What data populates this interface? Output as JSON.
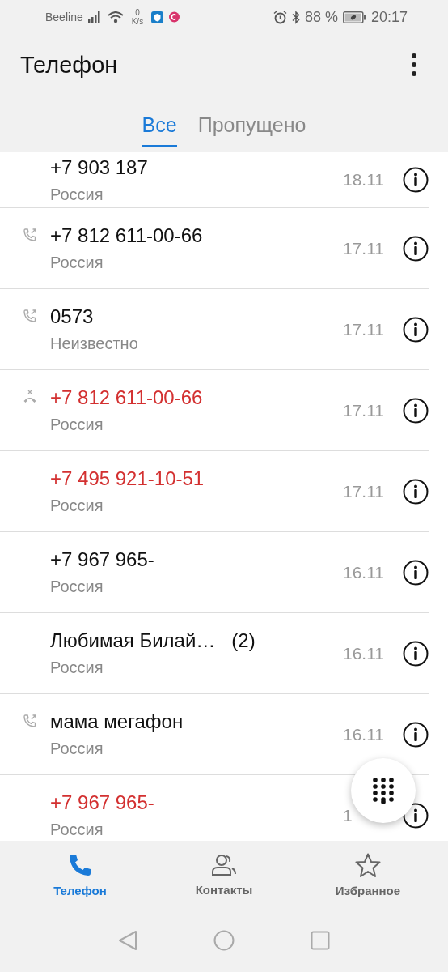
{
  "status_bar": {
    "carrier": "Beeline",
    "speed_value": "0",
    "speed_unit": "K/s",
    "battery": "88 %",
    "time": "20:17"
  },
  "app_bar": {
    "title": "Телефон"
  },
  "tabs": [
    {
      "label": "Все",
      "selected": true
    },
    {
      "label": "Пропущено",
      "selected": false
    }
  ],
  "calls": [
    {
      "name": "+7 903 187",
      "region": "Россия",
      "date": "18.11",
      "kind": "plain",
      "missed": false
    },
    {
      "name": "+7 812 611-00-66",
      "region": "Россия",
      "date": "17.11",
      "kind": "outgoing",
      "missed": false
    },
    {
      "name": "0573",
      "region": "Неизвестно",
      "date": "17.11",
      "kind": "outgoing",
      "missed": false
    },
    {
      "name": "+7 812 611-00-66",
      "region": "Россия",
      "date": "17.11",
      "kind": "rejected",
      "missed": true
    },
    {
      "name": "+7 495 921-10-51",
      "region": "Россия",
      "date": "17.11",
      "kind": "plain",
      "missed": true
    },
    {
      "name": "+7 967 965-",
      "region": "Россия",
      "date": "16.11",
      "kind": "plain",
      "missed": false
    },
    {
      "name": "Любимая Билай…",
      "count": "(2)",
      "region": "Россия",
      "date": "16.11",
      "kind": "plain",
      "missed": false
    },
    {
      "name": "мама мегафон",
      "region": "Россия",
      "date": "16.11",
      "kind": "outgoing",
      "missed": false
    },
    {
      "name": "+7 967 965-",
      "region": "Россия",
      "date": "1",
      "kind": "plain",
      "missed": true
    }
  ],
  "bottom_nav": [
    {
      "label": "Телефон",
      "kind": "phone",
      "selected": true
    },
    {
      "label": "Контакты",
      "kind": "contacts",
      "selected": false
    },
    {
      "label": "Избранное",
      "kind": "star",
      "selected": false
    }
  ]
}
